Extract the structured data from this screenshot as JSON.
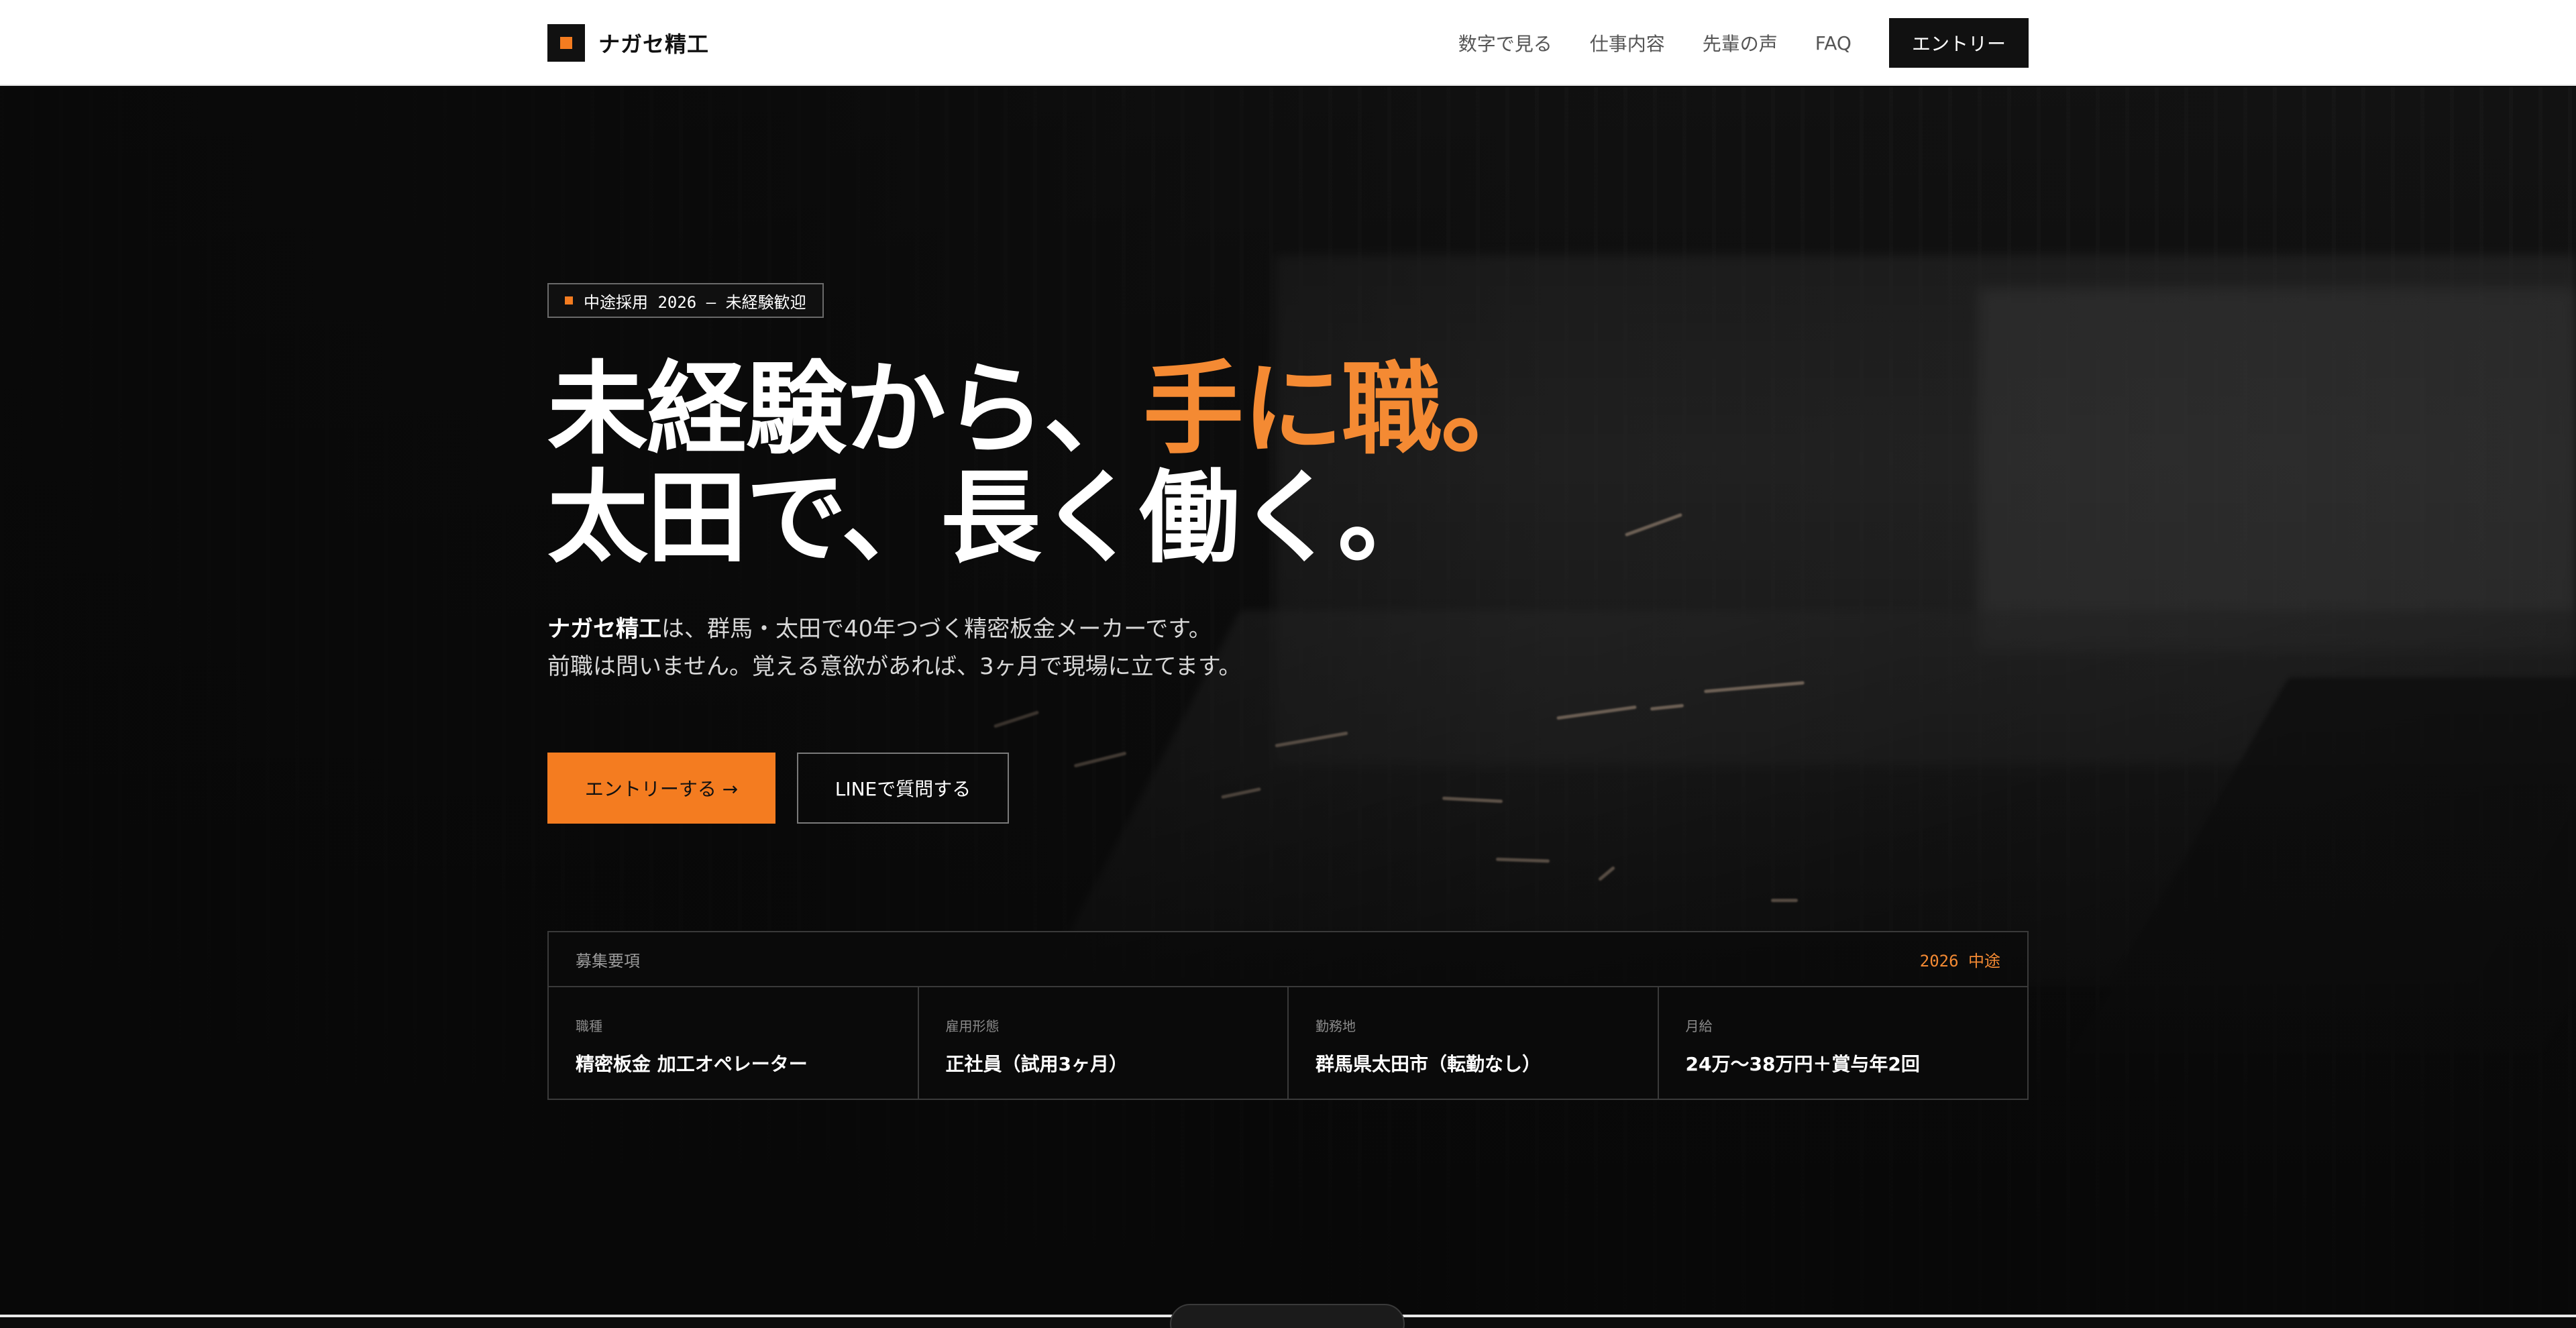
{
  "nav": {
    "brand": "ナガセ精工",
    "links": [
      "数字で見る",
      "仕事内容",
      "先輩の声",
      "FAQ"
    ],
    "cta": "エントリー"
  },
  "hero": {
    "tag": "中途採用 2026 — 未経験歓迎",
    "headline_line1": "未経験から、",
    "headline_accent": "手に職。",
    "headline_line2": "太田で、長く働く。",
    "lead_company": "ナガセ精工",
    "lead_line1_rest": "は、群馬・太田で40年つづく精密板金メーカーです。",
    "lead_line2": "前職は問いません。覚える意欲があれば、3ヶ月で現場に立てます。",
    "primary_button": "エントリーする →",
    "secondary_button": "LINEで質問する"
  },
  "recruit": {
    "title": "募集要項",
    "year": "2026 中途",
    "items": [
      {
        "label": "職種",
        "value": "精密板金 加工オペレーター"
      },
      {
        "label": "雇用形態",
        "value": "正社員（試用3ヶ月）"
      },
      {
        "label": "勤務地",
        "value": "群馬県太田市（転勤なし）"
      },
      {
        "label": "月給",
        "value": "24万〜38万円＋賞与年2回"
      }
    ]
  },
  "colors": {
    "accent": "#f47c20",
    "nav_bg": "#ffffff",
    "hero_bg": "#0c0c0c"
  }
}
